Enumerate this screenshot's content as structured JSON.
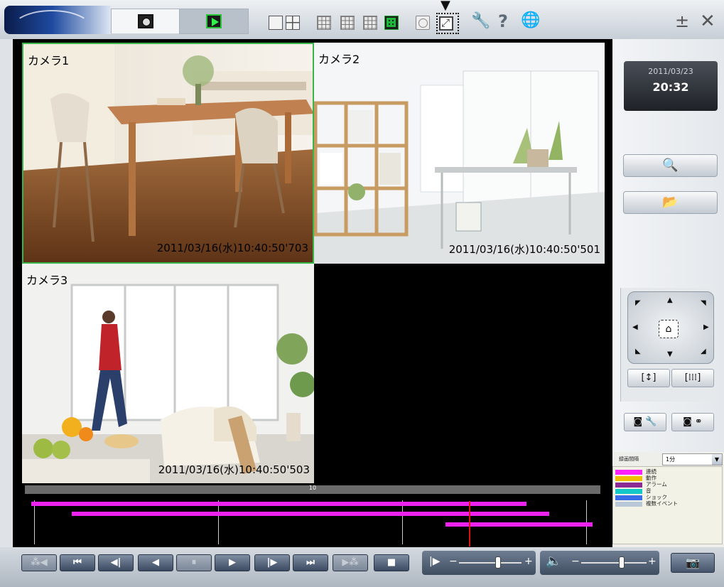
{
  "toolbar": {
    "tabs": [
      {
        "name": "live",
        "icon": "live-camera-icon",
        "selected": false
      },
      {
        "name": "playback",
        "icon": "play-icon",
        "selected": true
      }
    ],
    "layouts": [
      "1-screen",
      "4-screen",
      "9-screen",
      "16-screen",
      "16-screen-alt",
      "custom-layout"
    ],
    "selected_layout": "custom-layout",
    "sequence_icon": "sequence-icon",
    "fullscreen_icon": "fullscreen-icon",
    "setup_icon": "wrench-icon",
    "help_icon": "help-icon",
    "language_icon": "globe-icon",
    "help_glyph": "?",
    "minimize_glyph": "±",
    "close_glyph": "✕",
    "indicator_glyph": "▼"
  },
  "cameras": [
    {
      "name": "カメラ1",
      "timestamp": "2011/03/16(水)10:40:50'703",
      "selected": true,
      "scene": "dining-room"
    },
    {
      "name": "カメラ2",
      "timestamp": "2011/03/16(水)10:40:50'501",
      "selected": false,
      "scene": "living-room-shelf"
    },
    {
      "name": "カメラ3",
      "timestamp": "2011/03/16(水)10:40:50'503",
      "selected": false,
      "scene": "woman-walking"
    }
  ],
  "clock": {
    "date": "2011/03/23",
    "time": "20:32"
  },
  "side_buttons": {
    "search_icon": "search-icon",
    "open_icon": "folder-open-icon"
  },
  "ptz": {
    "home_icon": "home-icon",
    "zoom_wide_icon": "zoom-wide-icon",
    "zoom_tele_icon": "zoom-tele-icon",
    "preset_icon": "preset-icon",
    "link_icon": "camera-link-icon"
  },
  "record_filter": {
    "label": "録画間隔",
    "value": "1分"
  },
  "legend": [
    {
      "color": "#ff22ff",
      "label": "連続"
    },
    {
      "color": "#f0c000",
      "label": "動作"
    },
    {
      "color": "#8a2a92",
      "label": "アラーム"
    },
    {
      "color": "#14c8c8",
      "label": "音"
    },
    {
      "color": "#3a6ee8",
      "label": "ショック"
    },
    {
      "color": "#b8c8d8",
      "label": "複数イベント"
    }
  ],
  "timeline": {
    "scale_label": "10",
    "cursor_fraction": 0.77,
    "tracks": [
      {
        "start": 0.01,
        "end": 0.87
      },
      {
        "start": 0.08,
        "end": 0.91
      },
      {
        "start": 0.73,
        "end": 0.985
      }
    ]
  },
  "playback": {
    "buttons": [
      "skip-back-far",
      "skip-to-start",
      "step-back",
      "reverse-play",
      "pause",
      "play",
      "step-forward",
      "skip-to-end",
      "skip-forward-far",
      "stop"
    ],
    "speed_minus": "−",
    "speed_plus": "+",
    "volume_minus": "−",
    "volume_plus": "+",
    "speed_level": 0.62,
    "volume_level": 0.62,
    "snapshot_icon": "snapshot-icon"
  }
}
